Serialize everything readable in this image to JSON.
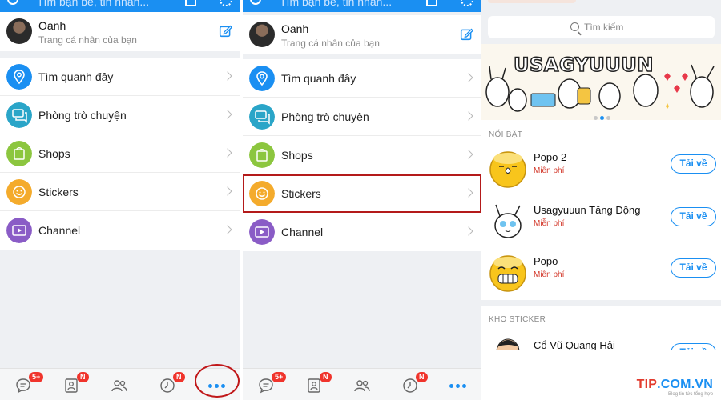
{
  "search": {
    "placeholder": "Tìm bạn bè, tin nhắn..."
  },
  "profile": {
    "name": "Oanh",
    "subtitle": "Trang cá nhân của bạn"
  },
  "menu": [
    {
      "label": "Tìm quanh đây",
      "icon": "location-pin-icon",
      "color": "#1a8ff2"
    },
    {
      "label": "Phòng trò chuyện",
      "icon": "chat-room-icon",
      "color": "#2aa5c8"
    },
    {
      "label": "Shops",
      "icon": "shopping-bag-icon",
      "color": "#8cc63f"
    },
    {
      "label": "Stickers",
      "icon": "smiley-icon",
      "color": "#f4ab2c"
    },
    {
      "label": "Channel",
      "icon": "video-channel-icon",
      "color": "#8a5cc6"
    }
  ],
  "bottom_nav": {
    "messages_badge": "5+",
    "contacts_badge": "N",
    "timeline_badge": "N"
  },
  "sticker_store": {
    "search_placeholder": "Tìm kiếm",
    "banner_title": "USAGYUUUN",
    "featured_heading": "NỔI BẬT",
    "featured": [
      {
        "name": "Popo 2",
        "price": "Miễn phí",
        "button": "Tải về"
      },
      {
        "name": "Usagyuuun Tăng Động",
        "price": "Miễn phí",
        "button": "Tải về"
      },
      {
        "name": "Popo",
        "price": "Miễn phí",
        "button": "Tải về"
      }
    ],
    "store_heading": "KHO STICKER",
    "store_items": [
      {
        "name": "Cổ Vũ Quang Hải",
        "button": "Tải về"
      }
    ]
  },
  "watermark": {
    "brand": "TIP",
    "domain": ".COM.VN",
    "tagline": "Blog tin tức tổng hợp"
  },
  "colors": {
    "accent": "#1a8ff2",
    "highlight": "#b41a1a",
    "price": "#d33a2c"
  }
}
